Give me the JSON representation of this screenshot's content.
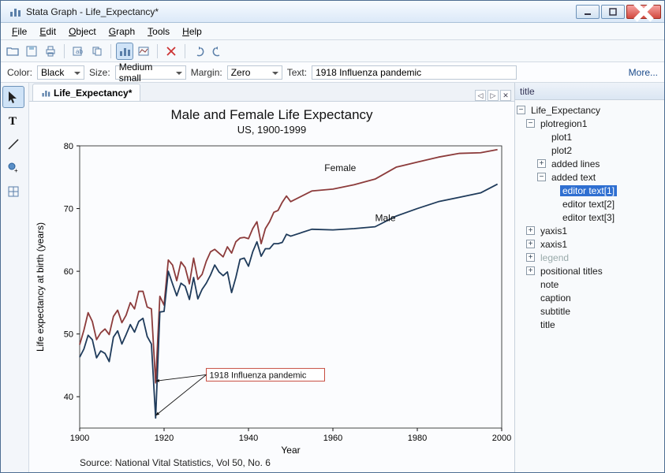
{
  "window": {
    "title": "Stata Graph - Life_Expectancy*"
  },
  "menu": {
    "file": "File",
    "edit": "Edit",
    "object": "Object",
    "graph": "Graph",
    "tools": "Tools",
    "help": "Help"
  },
  "props": {
    "color_label": "Color:",
    "color_value": "Black",
    "size_label": "Size:",
    "size_value": "Medium small",
    "margin_label": "Margin:",
    "margin_value": "Zero",
    "text_label": "Text:",
    "text_value": "1918 Influenza pandemic",
    "more": "More..."
  },
  "tab": {
    "label": "Life_Expectancy*"
  },
  "objbrowser": {
    "title": "title",
    "root": "Life_Expectancy",
    "plotregion": "plotregion1",
    "plot1": "plot1",
    "plot2": "plot2",
    "addedlines": "added lines",
    "addedtext": "added text",
    "et1": "editor text[1]",
    "et2": "editor text[2]",
    "et3": "editor text[3]",
    "yaxis": "yaxis1",
    "xaxis": "xaxis1",
    "legend": "legend",
    "positional": "positional titles",
    "note": "note",
    "caption": "caption",
    "subtitle": "subtitle"
  },
  "chart_data": {
    "type": "line",
    "title": "Male and Female Life Expectancy",
    "subtitle": "US, 1900-1999",
    "xlabel": "Year",
    "ylabel": "Life expectancy at birth (years)",
    "xlim": [
      1900,
      2000
    ],
    "ylim": [
      35,
      80
    ],
    "xticks": [
      1900,
      1920,
      1940,
      1960,
      1980,
      2000
    ],
    "yticks": [
      40,
      50,
      60,
      70,
      80
    ],
    "source": "Source:  National Vital Statistics, Vol 50, No. 6",
    "annotation": {
      "text": "1918 Influenza pandemic",
      "x": 1930,
      "y": 43,
      "arrows_to": [
        [
          1918,
          37
        ],
        [
          1918,
          42.5
        ]
      ]
    },
    "series_labels": {
      "female": {
        "text": "Female",
        "x": 1958,
        "y": 76
      },
      "male": {
        "text": "Male",
        "x": 1970,
        "y": 68
      }
    },
    "colors": {
      "female": "#8c3b3b",
      "male": "#1f3b5b"
    },
    "x": [
      1900,
      1901,
      1902,
      1903,
      1904,
      1905,
      1906,
      1907,
      1908,
      1909,
      1910,
      1911,
      1912,
      1913,
      1914,
      1915,
      1916,
      1917,
      1918,
      1919,
      1920,
      1921,
      1922,
      1923,
      1924,
      1925,
      1926,
      1927,
      1928,
      1929,
      1930,
      1931,
      1932,
      1933,
      1934,
      1935,
      1936,
      1937,
      1938,
      1939,
      1940,
      1941,
      1942,
      1943,
      1944,
      1945,
      1946,
      1947,
      1948,
      1949,
      1950,
      1955,
      1960,
      1965,
      1970,
      1975,
      1980,
      1985,
      1990,
      1995,
      1999
    ],
    "series": [
      {
        "name": "Female",
        "values": [
          48.3,
          50.6,
          53.4,
          52.0,
          49.1,
          50.2,
          50.8,
          49.9,
          52.8,
          53.8,
          51.8,
          53.0,
          55.0,
          54.0,
          56.8,
          56.8,
          54.3,
          54.0,
          42.2,
          56.0,
          54.6,
          61.8,
          61.0,
          58.5,
          61.5,
          60.6,
          58.0,
          62.1,
          58.7,
          59.5,
          61.6,
          63.1,
          63.5,
          62.9,
          62.3,
          63.9,
          62.9,
          64.7,
          65.3,
          65.4,
          65.2,
          66.8,
          67.9,
          64.4,
          66.8,
          67.9,
          69.4,
          69.7,
          71.0,
          72.0,
          71.1,
          72.8,
          73.1,
          73.8,
          74.7,
          76.6,
          77.4,
          78.2,
          78.8,
          78.9,
          79.4
        ]
      },
      {
        "name": "Male",
        "values": [
          46.3,
          47.6,
          49.8,
          49.1,
          46.2,
          47.3,
          46.9,
          45.6,
          49.5,
          50.5,
          48.4,
          49.9,
          51.5,
          50.3,
          52.0,
          52.5,
          49.6,
          48.4,
          36.6,
          53.5,
          53.6,
          60.0,
          58.0,
          56.1,
          58.1,
          57.6,
          55.5,
          59.0,
          55.6,
          57.1,
          58.1,
          59.4,
          61.0,
          59.9,
          59.3,
          59.9,
          56.6,
          59.0,
          61.9,
          62.1,
          60.8,
          63.1,
          64.7,
          62.4,
          63.6,
          63.6,
          64.4,
          64.4,
          64.6,
          65.9,
          65.6,
          66.7,
          66.6,
          66.8,
          67.1,
          68.8,
          70.0,
          71.1,
          71.8,
          72.5,
          73.9
        ]
      }
    ]
  }
}
